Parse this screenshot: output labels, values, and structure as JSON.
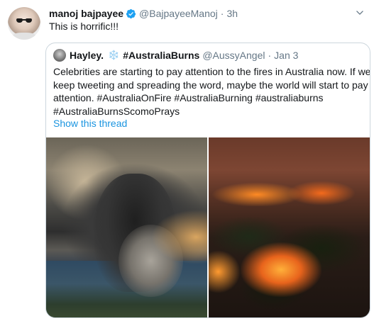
{
  "tweet": {
    "author_name": "manoj bajpayee",
    "author_handle": "@BajpayeeManoj",
    "separator": "·",
    "time": "3h",
    "text": "This is horrific!!!"
  },
  "quoted_tweet": {
    "author_name": "Hayley.",
    "emoji": "❄️",
    "hashtag_name": "#AustraliaBurns",
    "author_handle": "@AussyAngel",
    "separator": "·",
    "date": "Jan 3",
    "text_lines": [
      "Celebrities are starting to pay attention to the fires in Australia now. If we",
      "keep tweeting and spreading the word, maybe the world will start to pay",
      "attention. #AustraliaOnFire #AustraliaBurning #australiaburns",
      "#AustraliaBurnsScomoPrays"
    ],
    "show_thread_label": "Show this thread"
  },
  "icons": {
    "verified": "verified-badge-icon",
    "menu": "chevron-down-icon"
  },
  "colors": {
    "link": "#1b95e0",
    "secondary_text": "#657786",
    "verified": "#1da1f2",
    "border": "#ccd6dd"
  }
}
